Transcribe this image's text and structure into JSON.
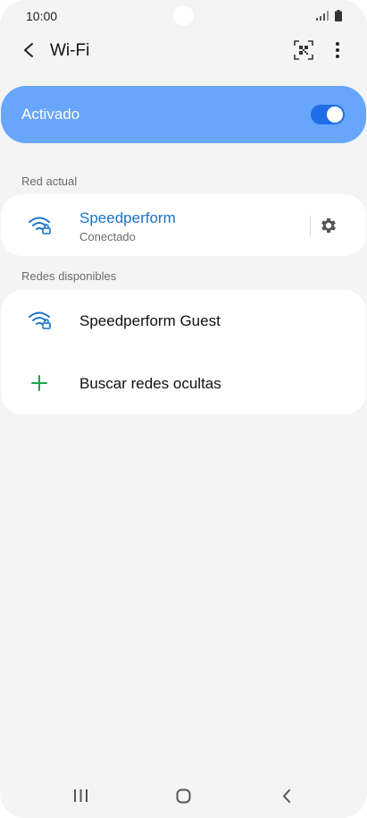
{
  "status_bar": {
    "time": "10:00"
  },
  "app_bar": {
    "title": "Wi-Fi"
  },
  "toggle": {
    "label": "Activado",
    "on": true
  },
  "current_network": {
    "section_label": "Red actual",
    "name": "Speedperform",
    "status": "Conectado"
  },
  "available": {
    "section_label": "Redes disponibles",
    "networks": [
      {
        "name": "Speedperform Guest"
      }
    ],
    "hidden_label": "Buscar redes ocultas"
  },
  "colors": {
    "accent": "#1f6ee8",
    "toggle_card": "#67a6fb",
    "connected_text": "#1a73c7",
    "plus": "#1aa34a"
  },
  "icons": [
    "signal-icon",
    "battery-icon",
    "back-arrow-icon",
    "qr-code-icon",
    "more-vert-icon",
    "wifi-lock-icon",
    "settings-gear-icon",
    "plus-icon",
    "nav-recent-icon",
    "nav-home-icon",
    "nav-back-icon"
  ]
}
